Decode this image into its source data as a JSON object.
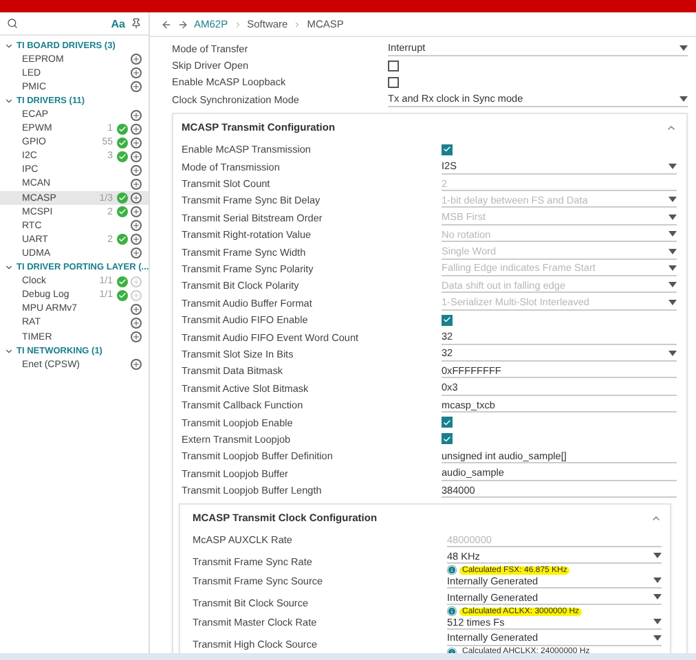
{
  "sidebar": {
    "case_toggle": "Aa",
    "groups": [
      {
        "title": "TI BOARD DRIVERS (3)",
        "expanded": true,
        "items": [
          {
            "label": "EEPROM",
            "ok": false,
            "add_disabled": false,
            "selected": false
          },
          {
            "label": "LED",
            "ok": false,
            "add_disabled": false,
            "selected": false
          },
          {
            "label": "PMIC",
            "ok": false,
            "add_disabled": false,
            "selected": false
          }
        ]
      },
      {
        "title": "TI DRIVERS (11)",
        "expanded": true,
        "items": [
          {
            "label": "ECAP",
            "ok": false,
            "add_disabled": false,
            "selected": false
          },
          {
            "label": "EPWM",
            "count": "1",
            "ok": true,
            "add_disabled": false,
            "selected": false
          },
          {
            "label": "GPIO",
            "count": "55",
            "ok": true,
            "add_disabled": false,
            "selected": false
          },
          {
            "label": "I2C",
            "count": "3",
            "ok": true,
            "add_disabled": false,
            "selected": false
          },
          {
            "label": "IPC",
            "ok": false,
            "add_disabled": false,
            "selected": false
          },
          {
            "label": "MCAN",
            "ok": false,
            "add_disabled": false,
            "selected": false
          },
          {
            "label": "MCASP",
            "count": "1/3",
            "ok": true,
            "add_disabled": false,
            "selected": true
          },
          {
            "label": "MCSPI",
            "count": "2",
            "ok": true,
            "add_disabled": false,
            "selected": false
          },
          {
            "label": "RTC",
            "ok": false,
            "add_disabled": false,
            "selected": false
          },
          {
            "label": "UART",
            "count": "2",
            "ok": true,
            "add_disabled": false,
            "selected": false
          },
          {
            "label": "UDMA",
            "ok": false,
            "add_disabled": false,
            "selected": false
          }
        ]
      },
      {
        "title": "TI DRIVER PORTING LAYER (...",
        "expanded": true,
        "items": [
          {
            "label": "Clock",
            "count": "1/1",
            "ok": true,
            "add_disabled": true,
            "selected": false
          },
          {
            "label": "Debug Log",
            "count": "1/1",
            "ok": true,
            "add_disabled": true,
            "selected": false
          },
          {
            "label": "MPU ARMv7",
            "ok": false,
            "add_disabled": false,
            "selected": false
          },
          {
            "label": "RAT",
            "ok": false,
            "add_disabled": false,
            "selected": false
          },
          {
            "label": "TIMER",
            "ok": false,
            "add_disabled": false,
            "selected": false
          }
        ]
      },
      {
        "title": "TI NETWORKING (1)",
        "expanded": true,
        "items": [
          {
            "label": "Enet (CPSW)",
            "ok": false,
            "add_disabled": false,
            "selected": false
          }
        ]
      }
    ]
  },
  "breadcrumb": [
    "AM62P",
    "Software",
    "MCASP"
  ],
  "top_rows": [
    {
      "label": "Mode of Transfer",
      "kind": "select",
      "value": "Interrupt",
      "disabled": false
    },
    {
      "label": "Skip Driver Open",
      "kind": "checkbox",
      "checked": false
    },
    {
      "label": "Enable McASP Loopback",
      "kind": "checkbox",
      "checked": false
    },
    {
      "label": "Clock Synchronization Mode",
      "kind": "select",
      "value": "Tx and Rx clock in Sync mode",
      "disabled": false
    }
  ],
  "transmit_card": {
    "title": "MCASP Transmit Configuration",
    "expanded": true,
    "rows": [
      {
        "label": "Enable McASP Transmission",
        "kind": "checkbox",
        "checked": true
      },
      {
        "label": "Mode of Transmission",
        "kind": "select",
        "value": "I2S",
        "disabled": false
      },
      {
        "label": "Transmit Slot Count",
        "kind": "text",
        "value": "2",
        "disabled": true
      },
      {
        "label": "Transmit Frame Sync Bit Delay",
        "kind": "select",
        "value": "1-bit delay between FS and Data",
        "disabled": true
      },
      {
        "label": "Transmit Serial Bitstream Order",
        "kind": "select",
        "value": "MSB First",
        "disabled": true
      },
      {
        "label": "Transmit Right-rotation Value",
        "kind": "select",
        "value": "No rotation",
        "disabled": true
      },
      {
        "label": "Transmit Frame Sync Width",
        "kind": "select",
        "value": "Single Word",
        "disabled": true
      },
      {
        "label": "Transmit Frame Sync Polarity",
        "kind": "select",
        "value": "Falling Edge indicates Frame Start",
        "disabled": true
      },
      {
        "label": "Transmit Bit Clock Polarity",
        "kind": "select",
        "value": "Data shift out in falling edge",
        "disabled": true
      },
      {
        "label": "Transmit Audio Buffer Format",
        "kind": "select",
        "value": "1-Serializer Multi-Slot Interleaved",
        "disabled": true
      },
      {
        "label": "Transmit Audio FIFO Enable",
        "kind": "checkbox",
        "checked": true
      },
      {
        "label": "Transmit Audio FIFO Event Word Count",
        "kind": "text",
        "value": "32",
        "disabled": false
      },
      {
        "label": "Transmit Slot Size In Bits",
        "kind": "select",
        "value": "32",
        "disabled": false
      },
      {
        "label": "Transmit Data Bitmask",
        "kind": "text",
        "value": "0xFFFFFFFF",
        "disabled": false
      },
      {
        "label": "Transmit Active Slot Bitmask",
        "kind": "text",
        "value": "0x3",
        "disabled": false
      },
      {
        "label": "Transmit Callback Function",
        "kind": "text",
        "value": "mcasp_txcb",
        "disabled": false
      },
      {
        "label": "Transmit Loopjob Enable",
        "kind": "checkbox",
        "checked": true
      },
      {
        "label": "Extern Transmit Loopjob",
        "kind": "checkbox",
        "checked": true
      },
      {
        "label": "Transmit Loopjob Buffer Definition",
        "kind": "text",
        "value": "unsigned int audio_sample[]",
        "disabled": false
      },
      {
        "label": "Transmit Loopjob Buffer",
        "kind": "text",
        "value": "audio_sample",
        "disabled": false
      },
      {
        "label": "Transmit Loopjob Buffer Length",
        "kind": "text",
        "value": "384000",
        "disabled": false
      }
    ],
    "clock_card": {
      "title": "MCASP Transmit Clock Configuration",
      "expanded": true,
      "rows": [
        {
          "label": "McASP AUXCLK Rate",
          "kind": "text",
          "value": "48000000",
          "disabled": true
        },
        {
          "label": "Transmit Frame Sync Rate",
          "kind": "select",
          "value": "48 KHz",
          "disabled": false,
          "helper": {
            "text": "Calculated FSX: 46.875 KHz",
            "highlighted": true
          }
        },
        {
          "label": "Transmit Frame Sync Source",
          "kind": "select",
          "value": "Internally Generated",
          "disabled": false
        },
        {
          "label": "Transmit Bit Clock Source",
          "kind": "select",
          "value": "Internally Generated",
          "disabled": false,
          "helper": {
            "text": "Calculated ACLKX: 3000000 Hz",
            "highlighted": true
          }
        },
        {
          "label": "Transmit Master Clock Rate",
          "kind": "select",
          "value": "512 times Fs",
          "disabled": false
        },
        {
          "label": "Transmit High Clock Source",
          "kind": "select",
          "value": "Internally Generated",
          "disabled": false,
          "helper": {
            "text": "Calculated AHCLKX: 24000000 Hz",
            "highlighted": false
          }
        }
      ]
    }
  }
}
